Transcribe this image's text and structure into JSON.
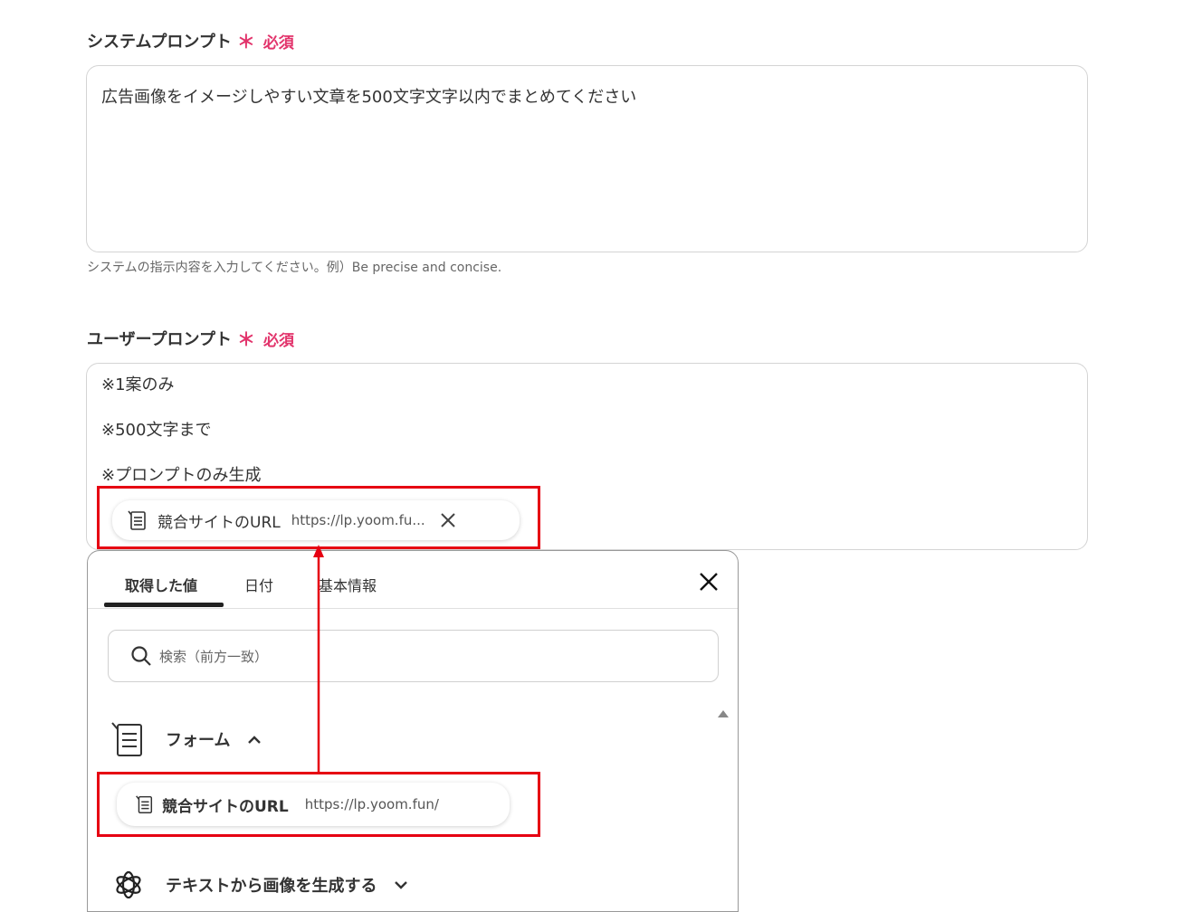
{
  "system_prompt": {
    "label": "システムプロンプト",
    "required_mark": "＊",
    "required_label": "必須",
    "value": "広告画像をイメージしやすい文章を500文字文字以内でまとめてください",
    "hint": "システムの指示内容を入力してください。例）Be precise and concise."
  },
  "user_prompt": {
    "label": "ユーザープロンプト",
    "required_mark": "＊",
    "required_label": "必須",
    "lines": [
      "※1案のみ",
      "※500文字まで",
      "※プロンプトのみ生成"
    ],
    "chip": {
      "icon": "form-icon",
      "name": "競合サイトのURL",
      "url": "https://lp.yoom.fu..."
    }
  },
  "picker": {
    "tabs": [
      "取得した値",
      "日付",
      "基本情報"
    ],
    "active_tab": 0,
    "search_placeholder": "検索（前方一致）",
    "groups": [
      {
        "icon": "form-icon",
        "name": "フォーム",
        "expanded": true,
        "items": [
          {
            "icon": "form-icon",
            "name": "競合サイトのURL",
            "value": "https://lp.yoom.fun/"
          }
        ]
      },
      {
        "icon": "openai-icon",
        "name": "テキストから画像を生成する",
        "expanded": false
      }
    ]
  },
  "colors": {
    "required": "#e2336b",
    "highlight": "#e60012",
    "tab_underline": "#222222"
  }
}
